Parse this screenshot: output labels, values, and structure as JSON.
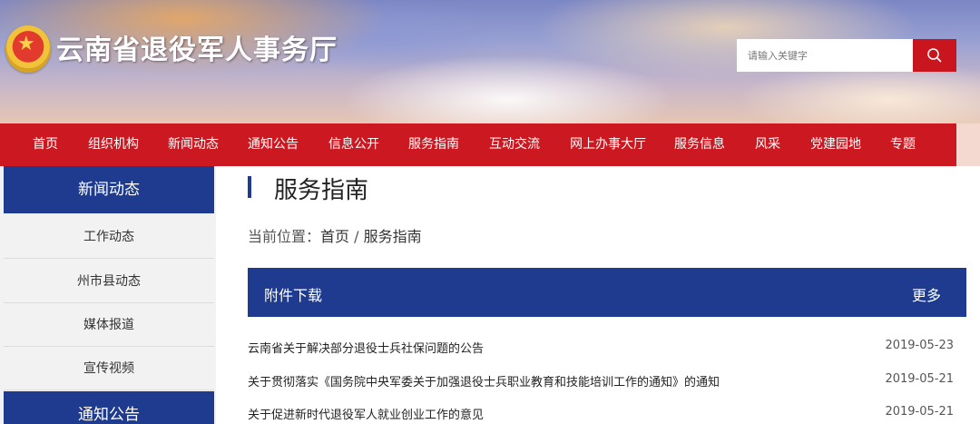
{
  "header": {
    "site_title": "云南省退役军人事务厅",
    "emblem_icon": "national-emblem",
    "search": {
      "placeholder": "请输入关键字",
      "button_icon": "search-icon"
    }
  },
  "nav": {
    "items": [
      "首页",
      "组织机构",
      "新闻动态",
      "通知公告",
      "信息公开",
      "服务指南",
      "互动交流",
      "网上办事大厅",
      "服务信息",
      "风采",
      "党建园地",
      "专题"
    ]
  },
  "sidebar": {
    "section1_title": "新闻动态",
    "items": [
      "工作动态",
      "州市县动态",
      "媒体报道",
      "宣传视频"
    ],
    "section2_title": "通知公告"
  },
  "main": {
    "page_title": "服务指南",
    "breadcrumb": {
      "prefix": "当前位置：",
      "home": "首页",
      "separator": " / ",
      "current": "服务指南"
    },
    "section": {
      "title": "附件下载",
      "more": "更多"
    },
    "rows": [
      {
        "title": "云南省关于解决部分退役士兵社保问题的公告",
        "date": "2019-05-23"
      },
      {
        "title": "关于贯彻落实《国务院中央军委关于加强退役士兵职业教育和技能培训工作的通知》的通知",
        "date": "2019-05-21"
      },
      {
        "title": "关于促进新时代退役军人就业创业工作的意见",
        "date": "2019-05-21"
      }
    ]
  },
  "colors": {
    "nav_red": "#cc1820",
    "navy": "#1f3b8f",
    "search_red": "#c9151e"
  }
}
